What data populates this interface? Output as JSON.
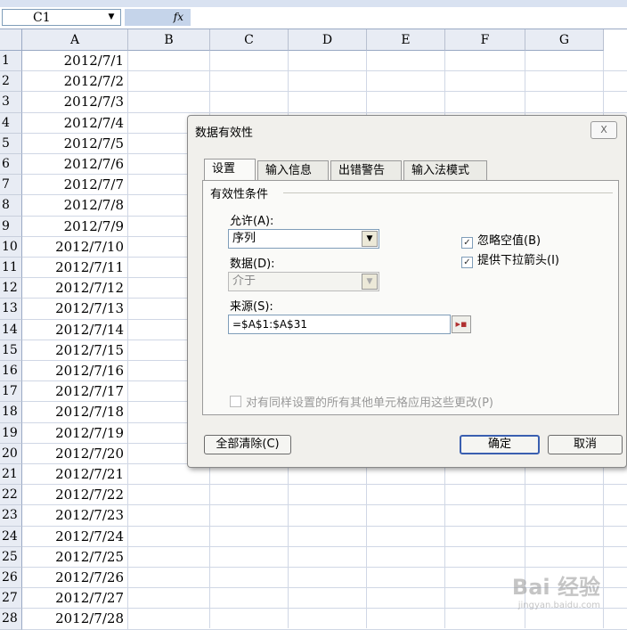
{
  "formula_bar": {
    "name_box": "C1",
    "fx_label": "fx"
  },
  "columns": [
    "A",
    "B",
    "C",
    "D",
    "E",
    "F",
    "G"
  ],
  "rows": [
    {
      "num": "1",
      "a": "2012/7/1"
    },
    {
      "num": "2",
      "a": "2012/7/2"
    },
    {
      "num": "3",
      "a": "2012/7/3"
    },
    {
      "num": "4",
      "a": "2012/7/4"
    },
    {
      "num": "5",
      "a": "2012/7/5"
    },
    {
      "num": "6",
      "a": "2012/7/6"
    },
    {
      "num": "7",
      "a": "2012/7/7"
    },
    {
      "num": "8",
      "a": "2012/7/8"
    },
    {
      "num": "9",
      "a": "2012/7/9"
    },
    {
      "num": "10",
      "a": "2012/7/10"
    },
    {
      "num": "11",
      "a": "2012/7/11"
    },
    {
      "num": "12",
      "a": "2012/7/12"
    },
    {
      "num": "13",
      "a": "2012/7/13"
    },
    {
      "num": "14",
      "a": "2012/7/14"
    },
    {
      "num": "15",
      "a": "2012/7/15"
    },
    {
      "num": "16",
      "a": "2012/7/16"
    },
    {
      "num": "17",
      "a": "2012/7/17"
    },
    {
      "num": "18",
      "a": "2012/7/18"
    },
    {
      "num": "19",
      "a": "2012/7/19"
    },
    {
      "num": "20",
      "a": "2012/7/20"
    },
    {
      "num": "21",
      "a": "2012/7/21"
    },
    {
      "num": "22",
      "a": "2012/7/22"
    },
    {
      "num": "23",
      "a": "2012/7/23"
    },
    {
      "num": "24",
      "a": "2012/7/24"
    },
    {
      "num": "25",
      "a": "2012/7/25"
    },
    {
      "num": "26",
      "a": "2012/7/26"
    },
    {
      "num": "27",
      "a": "2012/7/27"
    },
    {
      "num": "28",
      "a": "2012/7/28"
    }
  ],
  "dialog": {
    "title": "数据有效性",
    "close": "X",
    "tabs": [
      "设置",
      "输入信息",
      "出错警告",
      "输入法模式"
    ],
    "active_tab": "设置",
    "section": "有效性条件",
    "allow_label": "允许(A):",
    "allow_value": "序列",
    "data_label": "数据(D):",
    "data_value": "介于",
    "ignore_blank": "忽略空值(B)",
    "dropdown_arrow": "提供下拉箭头(I)",
    "source_label": "来源(S):",
    "source_value": "=$A$1:$A$31",
    "apply_all": "对有同样设置的所有其他单元格应用这些更改(P)",
    "clear_all": "全部清除(C)",
    "ok": "确定",
    "cancel": "取消"
  },
  "watermark": {
    "brand": "Bai 经验",
    "url": "jingyan.baidu.com"
  }
}
